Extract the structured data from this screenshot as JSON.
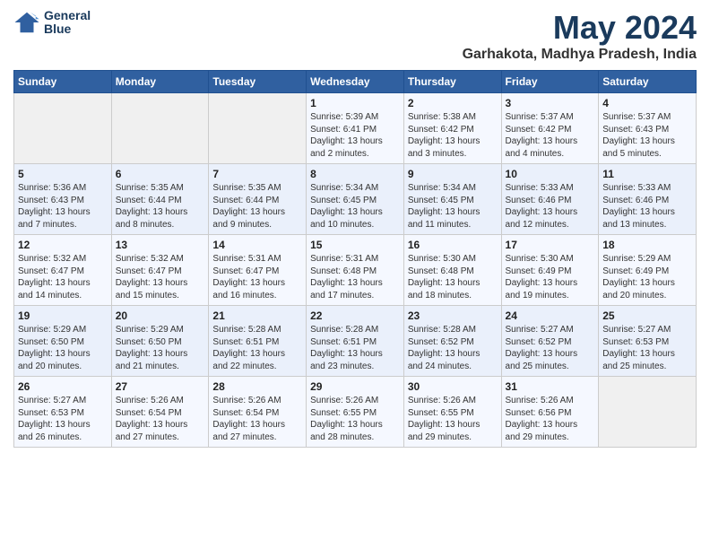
{
  "header": {
    "logo_line1": "General",
    "logo_line2": "Blue",
    "title": "May 2024",
    "subtitle": "Garhakota, Madhya Pradesh, India"
  },
  "weekdays": [
    "Sunday",
    "Monday",
    "Tuesday",
    "Wednesday",
    "Thursday",
    "Friday",
    "Saturday"
  ],
  "weeks": [
    [
      {
        "day": "",
        "detail": ""
      },
      {
        "day": "",
        "detail": ""
      },
      {
        "day": "",
        "detail": ""
      },
      {
        "day": "1",
        "detail": "Sunrise: 5:39 AM\nSunset: 6:41 PM\nDaylight: 13 hours\nand 2 minutes."
      },
      {
        "day": "2",
        "detail": "Sunrise: 5:38 AM\nSunset: 6:42 PM\nDaylight: 13 hours\nand 3 minutes."
      },
      {
        "day": "3",
        "detail": "Sunrise: 5:37 AM\nSunset: 6:42 PM\nDaylight: 13 hours\nand 4 minutes."
      },
      {
        "day": "4",
        "detail": "Sunrise: 5:37 AM\nSunset: 6:43 PM\nDaylight: 13 hours\nand 5 minutes."
      }
    ],
    [
      {
        "day": "5",
        "detail": "Sunrise: 5:36 AM\nSunset: 6:43 PM\nDaylight: 13 hours\nand 7 minutes."
      },
      {
        "day": "6",
        "detail": "Sunrise: 5:35 AM\nSunset: 6:44 PM\nDaylight: 13 hours\nand 8 minutes."
      },
      {
        "day": "7",
        "detail": "Sunrise: 5:35 AM\nSunset: 6:44 PM\nDaylight: 13 hours\nand 9 minutes."
      },
      {
        "day": "8",
        "detail": "Sunrise: 5:34 AM\nSunset: 6:45 PM\nDaylight: 13 hours\nand 10 minutes."
      },
      {
        "day": "9",
        "detail": "Sunrise: 5:34 AM\nSunset: 6:45 PM\nDaylight: 13 hours\nand 11 minutes."
      },
      {
        "day": "10",
        "detail": "Sunrise: 5:33 AM\nSunset: 6:46 PM\nDaylight: 13 hours\nand 12 minutes."
      },
      {
        "day": "11",
        "detail": "Sunrise: 5:33 AM\nSunset: 6:46 PM\nDaylight: 13 hours\nand 13 minutes."
      }
    ],
    [
      {
        "day": "12",
        "detail": "Sunrise: 5:32 AM\nSunset: 6:47 PM\nDaylight: 13 hours\nand 14 minutes."
      },
      {
        "day": "13",
        "detail": "Sunrise: 5:32 AM\nSunset: 6:47 PM\nDaylight: 13 hours\nand 15 minutes."
      },
      {
        "day": "14",
        "detail": "Sunrise: 5:31 AM\nSunset: 6:47 PM\nDaylight: 13 hours\nand 16 minutes."
      },
      {
        "day": "15",
        "detail": "Sunrise: 5:31 AM\nSunset: 6:48 PM\nDaylight: 13 hours\nand 17 minutes."
      },
      {
        "day": "16",
        "detail": "Sunrise: 5:30 AM\nSunset: 6:48 PM\nDaylight: 13 hours\nand 18 minutes."
      },
      {
        "day": "17",
        "detail": "Sunrise: 5:30 AM\nSunset: 6:49 PM\nDaylight: 13 hours\nand 19 minutes."
      },
      {
        "day": "18",
        "detail": "Sunrise: 5:29 AM\nSunset: 6:49 PM\nDaylight: 13 hours\nand 20 minutes."
      }
    ],
    [
      {
        "day": "19",
        "detail": "Sunrise: 5:29 AM\nSunset: 6:50 PM\nDaylight: 13 hours\nand 20 minutes."
      },
      {
        "day": "20",
        "detail": "Sunrise: 5:29 AM\nSunset: 6:50 PM\nDaylight: 13 hours\nand 21 minutes."
      },
      {
        "day": "21",
        "detail": "Sunrise: 5:28 AM\nSunset: 6:51 PM\nDaylight: 13 hours\nand 22 minutes."
      },
      {
        "day": "22",
        "detail": "Sunrise: 5:28 AM\nSunset: 6:51 PM\nDaylight: 13 hours\nand 23 minutes."
      },
      {
        "day": "23",
        "detail": "Sunrise: 5:28 AM\nSunset: 6:52 PM\nDaylight: 13 hours\nand 24 minutes."
      },
      {
        "day": "24",
        "detail": "Sunrise: 5:27 AM\nSunset: 6:52 PM\nDaylight: 13 hours\nand 25 minutes."
      },
      {
        "day": "25",
        "detail": "Sunrise: 5:27 AM\nSunset: 6:53 PM\nDaylight: 13 hours\nand 25 minutes."
      }
    ],
    [
      {
        "day": "26",
        "detail": "Sunrise: 5:27 AM\nSunset: 6:53 PM\nDaylight: 13 hours\nand 26 minutes."
      },
      {
        "day": "27",
        "detail": "Sunrise: 5:26 AM\nSunset: 6:54 PM\nDaylight: 13 hours\nand 27 minutes."
      },
      {
        "day": "28",
        "detail": "Sunrise: 5:26 AM\nSunset: 6:54 PM\nDaylight: 13 hours\nand 27 minutes."
      },
      {
        "day": "29",
        "detail": "Sunrise: 5:26 AM\nSunset: 6:55 PM\nDaylight: 13 hours\nand 28 minutes."
      },
      {
        "day": "30",
        "detail": "Sunrise: 5:26 AM\nSunset: 6:55 PM\nDaylight: 13 hours\nand 29 minutes."
      },
      {
        "day": "31",
        "detail": "Sunrise: 5:26 AM\nSunset: 6:56 PM\nDaylight: 13 hours\nand 29 minutes."
      },
      {
        "day": "",
        "detail": ""
      }
    ]
  ]
}
